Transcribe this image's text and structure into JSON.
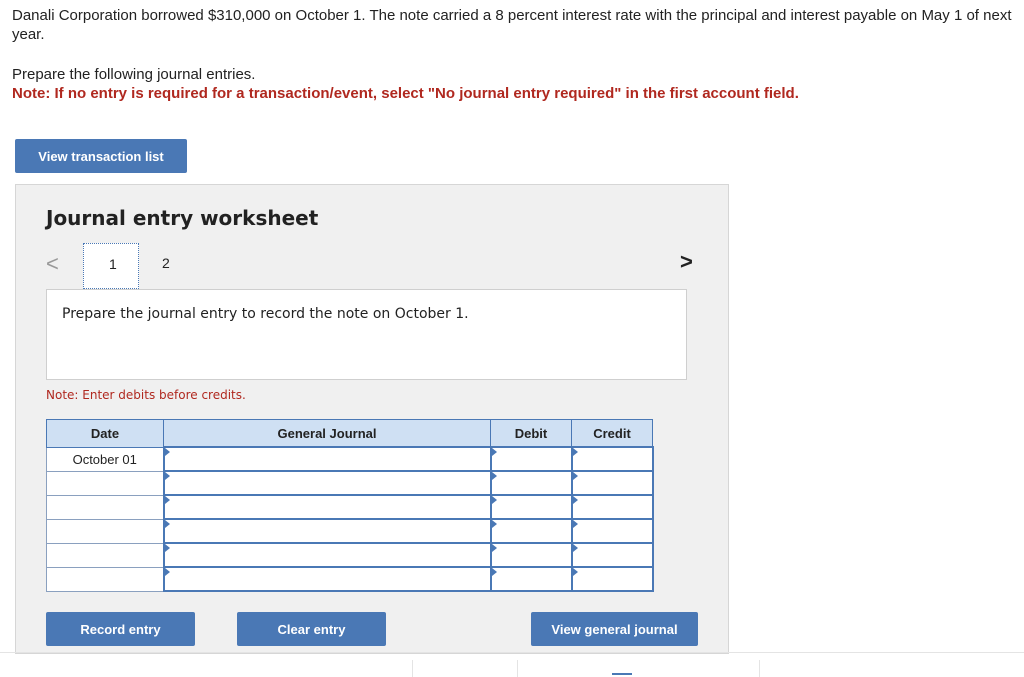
{
  "intro": "Danali Corporation borrowed $310,000 on October 1. The note carried a 8 percent interest rate with the principal and interest payable on May 1 of next year.",
  "prepare_text": "Prepare the following journal entries.",
  "note_red": "Note: If no entry is required for a transaction/event, select \"No journal entry required\" in the first account field.",
  "view_transaction_label": "View transaction list",
  "worksheet": {
    "title": "Journal entry worksheet",
    "nav_prev": "<",
    "nav_next": ">",
    "tabs": [
      "1",
      "2"
    ],
    "description": "Prepare the journal entry to record the note on October 1.",
    "note": "Note: Enter debits before credits."
  },
  "table": {
    "headers": [
      "Date",
      "General Journal",
      "Debit",
      "Credit"
    ],
    "rows": [
      {
        "date": "October 01"
      },
      {
        "date": ""
      },
      {
        "date": ""
      },
      {
        "date": ""
      },
      {
        "date": ""
      },
      {
        "date": ""
      }
    ]
  },
  "buttons": {
    "record": "Record entry",
    "clear": "Clear entry",
    "view_journal": "View general journal"
  }
}
